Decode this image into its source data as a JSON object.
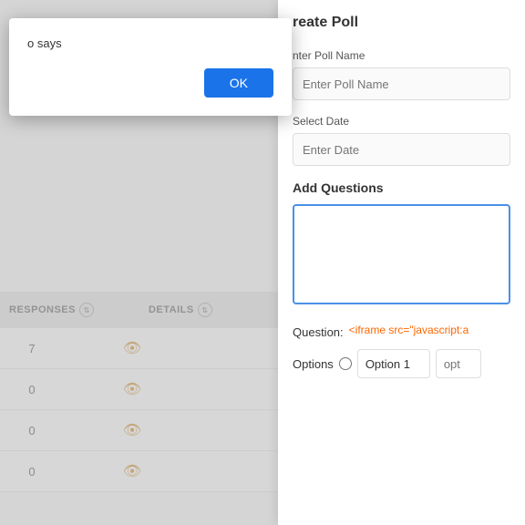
{
  "browser": {
    "top_height": 10
  },
  "alert": {
    "text": "o says",
    "ok_label": "OK"
  },
  "table": {
    "columns": [
      "RESPONSES",
      "DETAILS"
    ],
    "rows": [
      {
        "responses": "7",
        "has_eye": true
      },
      {
        "responses": "0",
        "has_eye": true
      },
      {
        "responses": "0",
        "has_eye": true
      },
      {
        "responses": "0",
        "has_eye": true
      }
    ]
  },
  "create_poll": {
    "title": "reate Poll",
    "poll_name_label": "nter Poll Name",
    "poll_name_placeholder": "Enter Poll Name",
    "select_date_label": "Select Date",
    "select_date_placeholder": "Enter Date",
    "add_questions_label": "Add Questions",
    "question_label": "Question:",
    "question_value": "<iframe src=\"javascript:a",
    "options_label": "Options",
    "option1_value": "Option 1",
    "option2_placeholder": "opt"
  }
}
